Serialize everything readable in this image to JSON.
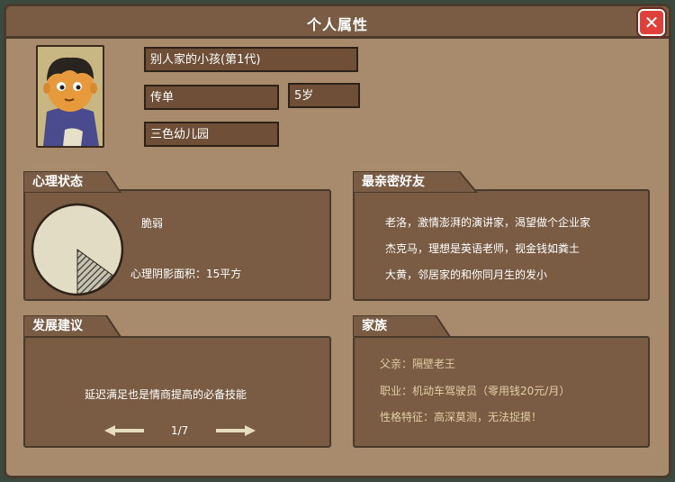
{
  "window": {
    "title": "个人属性"
  },
  "profile": {
    "name": "别人家的小孩(第1代)",
    "job": "传单",
    "age": "5岁",
    "school": "三色幼儿园"
  },
  "mental": {
    "tab": "心理状态",
    "status": "脆弱",
    "shadow_label": "心理阴影面积：15平方",
    "shadow_fraction": 0.15
  },
  "friends": {
    "tab": "最亲密好友",
    "items": [
      "老洛，激情澎湃的演讲家，渴望做个企业家",
      "杰克马，理想是英语老师，视金钱如粪土",
      "大黄，邻居家的和你同月生的发小"
    ]
  },
  "advice": {
    "tab": "发展建议",
    "text": "延迟满足也是情商提高的必备技能",
    "page": "1/7"
  },
  "family": {
    "tab": "家族",
    "lines": [
      "父亲：隔壁老王",
      "职业：机动车驾驶员（零用钱20元/月）",
      "性格特征：高深莫测，无法捉摸！"
    ]
  },
  "icons": {
    "close": "close-icon",
    "prev": "arrow-left-icon",
    "next": "arrow-right-icon"
  },
  "colors": {
    "background": "#a88a6c",
    "panel": "#7a5c44",
    "field": "#6f4f38",
    "close": "#e0403a",
    "family_text": "#e2cfa4"
  }
}
